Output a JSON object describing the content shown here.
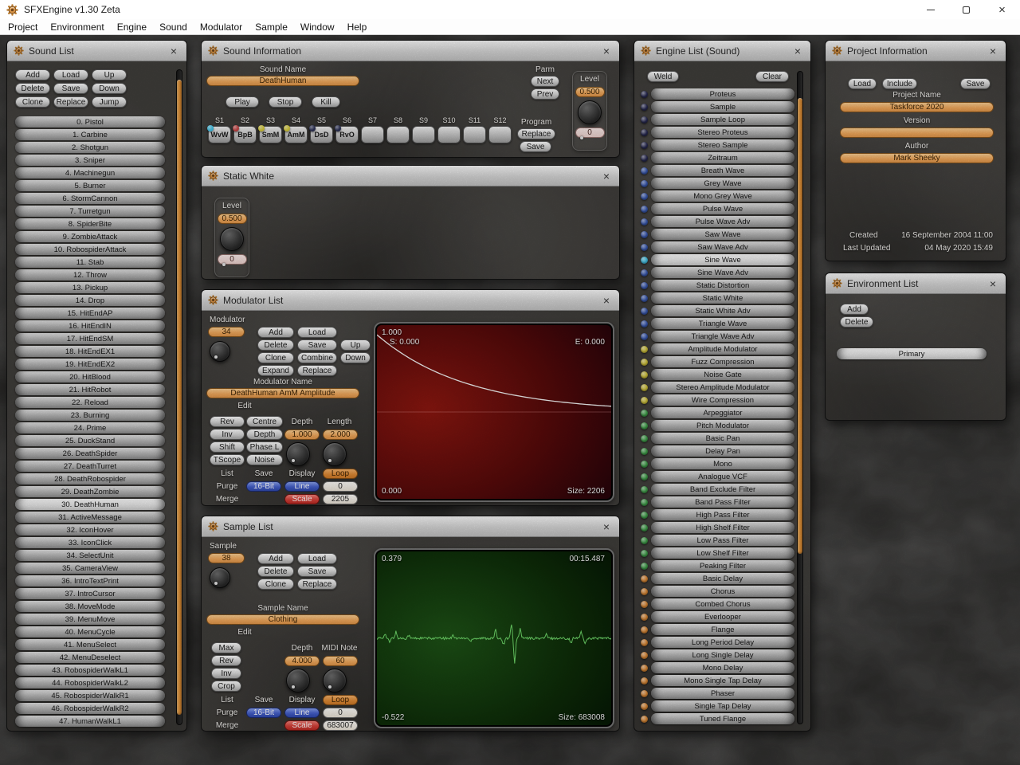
{
  "window": {
    "title": "SFXEngine v1.30 Zeta",
    "menu": [
      "Project",
      "Environment",
      "Engine",
      "Sound",
      "Modulator",
      "Sample",
      "Window",
      "Help"
    ]
  },
  "sound_list": {
    "title": "Sound List",
    "buttons": [
      "Add",
      "Load",
      "Up",
      "Delete",
      "Save",
      "Down",
      "Clone",
      "Replace",
      "Jump"
    ],
    "selected_index": 30,
    "items": [
      "0. Pistol",
      "1. Carbine",
      "2. Shotgun",
      "3. Sniper",
      "4. Machinegun",
      "5. Burner",
      "6. StormCannon",
      "7. Turretgun",
      "8. SpiderBite",
      "9. ZombieAttack",
      "10. RobospiderAttack",
      "11. Stab",
      "12. Throw",
      "13. Pickup",
      "14. Drop",
      "15. HitEndAP",
      "16. HitEndIN",
      "17. HitEndSM",
      "18. HitEndEX1",
      "19. HitEndEX2",
      "20. HitBlood",
      "21. HitRobot",
      "22. Reload",
      "23. Burning",
      "24. Prime",
      "25. DuckStand",
      "26. DeathSpider",
      "27. DeathTurret",
      "28. DeathRobospider",
      "29. DeathZombie",
      "30. DeathHuman",
      "31. ActiveMessage",
      "32. IconHover",
      "33. IconClick",
      "34. SelectUnit",
      "35. CameraView",
      "36. IntroTextPrint",
      "37. IntroCursor",
      "38. MoveMode",
      "39. MenuMove",
      "40. MenuCycle",
      "41. MenuSelect",
      "42. MenuDeselect",
      "43. RobospiderWalkL1",
      "44. RobospiderWalkL2",
      "45. RobospiderWalkR1",
      "46. RobospiderWalkR2",
      "47. HumanWalkL1"
    ]
  },
  "sound_info": {
    "title": "Sound Information",
    "name_label": "Sound Name",
    "name_value": "DeathHuman",
    "transport": [
      "Play",
      "Stop",
      "Kill"
    ],
    "parm_label": "Parm",
    "parm_buttons": [
      "Next",
      "Prev"
    ],
    "program_label": "Program",
    "program_buttons": [
      "Replace",
      "Save"
    ],
    "level": {
      "label": "Level",
      "value": "0.500",
      "out": "0"
    },
    "slots": [
      {
        "s": "S1",
        "label": "WvW",
        "dot": "#42c4e8"
      },
      {
        "s": "S2",
        "label": "BpB",
        "dot": "#c64444"
      },
      {
        "s": "S3",
        "label": "SmM",
        "dot": "#d6ca3a"
      },
      {
        "s": "S4",
        "label": "AmM",
        "dot": "#d6ca3a"
      },
      {
        "s": "S5",
        "label": "DsD",
        "dot": "#2c3156"
      },
      {
        "s": "S6",
        "label": "RvO",
        "dot": "#2c3156"
      },
      {
        "s": "S7",
        "label": ""
      },
      {
        "s": "S8",
        "label": ""
      },
      {
        "s": "S9",
        "label": ""
      },
      {
        "s": "S10",
        "label": ""
      },
      {
        "s": "S11",
        "label": ""
      },
      {
        "s": "S12",
        "label": ""
      }
    ]
  },
  "static_white": {
    "title": "Static White",
    "level": {
      "label": "Level",
      "value": "0.500",
      "out": "0"
    }
  },
  "modulator": {
    "title": "Modulator List",
    "index_label": "Modulator",
    "index_value": "34",
    "grid_buttons": [
      "Add",
      "Load",
      null,
      "Delete",
      "Save",
      "Up",
      "Clone",
      "Combine",
      "Down",
      "Expand",
      "Replace",
      null
    ],
    "name_label": "Modulator Name",
    "name_value": "DeathHuman AmM Amplitude",
    "edit_label": "Edit",
    "toggles": [
      "Rev",
      "Centre",
      "Inv",
      "Depth",
      "Shift",
      "Phase L",
      "TScope",
      "Noise"
    ],
    "depth_label": "Depth",
    "length_label": "Length",
    "depth_value": "1.000",
    "length_value": "2.000",
    "io": {
      "list": "List",
      "save": "Save",
      "display": "Display",
      "loop": "Loop",
      "purge": "Purge",
      "bit": "16-Bit",
      "line": "Line",
      "zero": "0",
      "merge": "Merge",
      "scale": "Scale",
      "count": "2205"
    },
    "graph": {
      "top": "1.000",
      "start": "S: 0.000",
      "end": "E: 0.000",
      "bottom": "0.000",
      "size": "Size: 2206"
    }
  },
  "sample": {
    "title": "Sample List",
    "index_label": "Sample",
    "index_value": "38",
    "grid_buttons": [
      "Add",
      "Load",
      "Delete",
      "Save",
      "Clone",
      "Replace"
    ],
    "name_label": "Sample Name",
    "name_value": "Clothing",
    "edit_label": "Edit",
    "toggles": [
      "Max",
      "Rev",
      "Inv",
      "Crop"
    ],
    "depth_label": "Depth",
    "midi_label": "MIDI Note",
    "depth_value": "4.000",
    "midi_value": "60",
    "io": {
      "list": "List",
      "save": "Save",
      "display": "Display",
      "loop": "Loop",
      "purge": "Purge",
      "bit": "16-Bit",
      "line": "Line",
      "zero": "0",
      "merge": "Merge",
      "scale": "Scale",
      "count": "683007"
    },
    "wave": {
      "max": "0.379",
      "time": "00:15.487",
      "min": "-0.522",
      "size": "Size: 683008"
    }
  },
  "engine_list": {
    "title": "Engine List (Sound)",
    "weld_label": "Weld",
    "clear_label": "Clear",
    "selected_index": 13,
    "items": [
      {
        "label": "Proteus",
        "dot": "#2a2c55"
      },
      {
        "label": "Sample",
        "dot": "#2a2c55"
      },
      {
        "label": "Sample Loop",
        "dot": "#2a2c55"
      },
      {
        "label": "Stereo Proteus",
        "dot": "#2a2c55"
      },
      {
        "label": "Stereo Sample",
        "dot": "#2a2c55"
      },
      {
        "label": "Zeitraum",
        "dot": "#2a2c55"
      },
      {
        "label": "Breath Wave",
        "dot": "#3b5bb4"
      },
      {
        "label": "Grey Wave",
        "dot": "#3b5bb4"
      },
      {
        "label": "Mono Grey Wave",
        "dot": "#3b5bb4"
      },
      {
        "label": "Pulse Wave",
        "dot": "#3b5bb4"
      },
      {
        "label": "Pulse Wave Adv",
        "dot": "#3b5bb4"
      },
      {
        "label": "Saw Wave",
        "dot": "#3b5bb4"
      },
      {
        "label": "Saw Wave Adv",
        "dot": "#3b5bb4"
      },
      {
        "label": "Sine Wave",
        "dot": "#45c6ea"
      },
      {
        "label": "Sine Wave Adv",
        "dot": "#3b5bb4"
      },
      {
        "label": "Static Distortion",
        "dot": "#3b5bb4"
      },
      {
        "label": "Static White",
        "dot": "#3b5bb4"
      },
      {
        "label": "Static White Adv",
        "dot": "#3b5bb4"
      },
      {
        "label": "Triangle Wave",
        "dot": "#3b5bb4"
      },
      {
        "label": "Triangle Wave Adv",
        "dot": "#3b5bb4"
      },
      {
        "label": "Amplitude Modulator",
        "dot": "#d3c53a"
      },
      {
        "label": "Fuzz Compression",
        "dot": "#d3c53a"
      },
      {
        "label": "Noise Gate",
        "dot": "#d3c53a"
      },
      {
        "label": "Stereo Amplitude Modulator",
        "dot": "#d3c53a"
      },
      {
        "label": "Wire Compression",
        "dot": "#d3c53a"
      },
      {
        "label": "Arpeggiator",
        "dot": "#41a24b"
      },
      {
        "label": "Pitch Modulator",
        "dot": "#41a24b"
      },
      {
        "label": "Basic Pan",
        "dot": "#41a24b"
      },
      {
        "label": "Delay Pan",
        "dot": "#41a24b"
      },
      {
        "label": "Mono",
        "dot": "#41a24b"
      },
      {
        "label": "Analogue VCF",
        "dot": "#41a24b"
      },
      {
        "label": "Band Exclude Filter",
        "dot": "#41a24b"
      },
      {
        "label": "Band Pass Filter",
        "dot": "#41a24b"
      },
      {
        "label": "High Pass Filter",
        "dot": "#41a24b"
      },
      {
        "label": "High Shelf Filter",
        "dot": "#41a24b"
      },
      {
        "label": "Low Pass Filter",
        "dot": "#41a24b"
      },
      {
        "label": "Low Shelf Filter",
        "dot": "#41a24b"
      },
      {
        "label": "Peaking Filter",
        "dot": "#41a24b"
      },
      {
        "label": "Basic Delay",
        "dot": "#de8a35"
      },
      {
        "label": "Chorus",
        "dot": "#de8a35"
      },
      {
        "label": "Combed Chorus",
        "dot": "#de8a35"
      },
      {
        "label": "Everlooper",
        "dot": "#de8a35"
      },
      {
        "label": "Flange",
        "dot": "#de8a35"
      },
      {
        "label": "Long Period Delay",
        "dot": "#de8a35"
      },
      {
        "label": "Long Single Delay",
        "dot": "#de8a35"
      },
      {
        "label": "Mono Delay",
        "dot": "#de8a35"
      },
      {
        "label": "Mono Single Tap Delay",
        "dot": "#de8a35"
      },
      {
        "label": "Phaser",
        "dot": "#de8a35"
      },
      {
        "label": "Single Tap Delay",
        "dot": "#de8a35"
      },
      {
        "label": "Tuned Flange",
        "dot": "#de8a35"
      }
    ]
  },
  "project": {
    "title": "Project Information",
    "buttons": [
      "Load",
      "Include",
      "Save"
    ],
    "name_label": "Project Name",
    "name_value": "Taskforce 2020",
    "version_label": "Version",
    "version_value": "",
    "author_label": "Author",
    "author_value": "Mark Sheeky",
    "created_label": "Created",
    "created_value": "16 September 2004 11:00",
    "updated_label": "Last Updated",
    "updated_value": "04 May 2020 15:49"
  },
  "environment": {
    "title": "Environment List",
    "buttons": [
      "Add",
      "Delete"
    ],
    "selected_index": 0,
    "items": [
      "Primary"
    ]
  }
}
